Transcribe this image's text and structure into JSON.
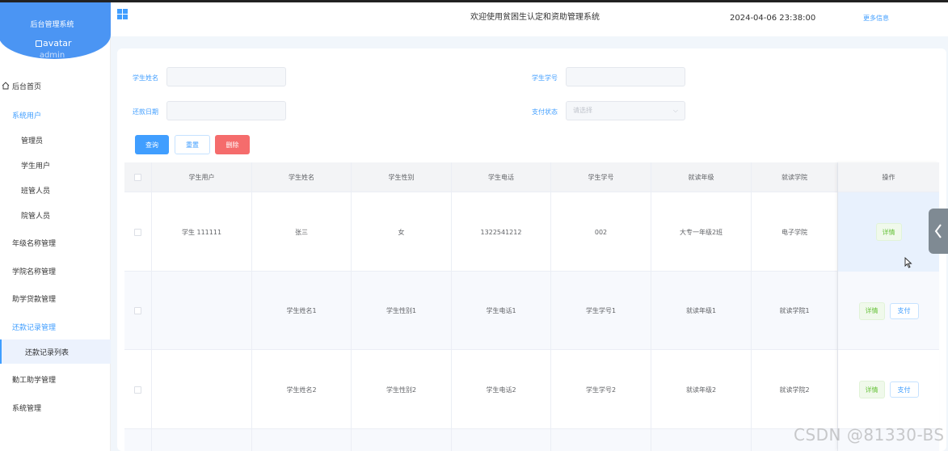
{
  "sidebar": {
    "brand_title": "后台管理系统",
    "avatar_alt": "avatar",
    "username": "admin",
    "items": [
      {
        "label": "后台首页"
      },
      {
        "label": "系统用户"
      },
      {
        "label": "管理员"
      },
      {
        "label": "学生用户"
      },
      {
        "label": "班管人员"
      },
      {
        "label": "院管人员"
      },
      {
        "label": "年级名称管理"
      },
      {
        "label": "学院名称管理"
      },
      {
        "label": "助学贷款管理"
      },
      {
        "label": "还款记录管理"
      },
      {
        "label": "还款记录列表"
      },
      {
        "label": "勤工助学管理"
      },
      {
        "label": "系统管理"
      }
    ]
  },
  "header": {
    "title": "欢迎使用贫困生认定和资助管理系统",
    "datetime": "2024-04-06 23:38:00",
    "more": "更多信息"
  },
  "search": {
    "name_label": "学生姓名",
    "id_label": "学生学号",
    "date_label": "还款日期",
    "status_label": "支付状态",
    "status_placeholder": "请选择",
    "query_btn": "查询",
    "reset_btn": "重置",
    "delete_btn": "删除"
  },
  "table": {
    "headers": [
      "学生用户",
      "学生姓名",
      "学生性别",
      "学生电话",
      "学生学号",
      "就读年级",
      "就读学院",
      "操作"
    ],
    "rows": [
      {
        "user": "学生 111111",
        "name": "张三",
        "gender": "女",
        "phone": "1322541212",
        "sid": "002",
        "grade": "大专一年级2班",
        "college": "电子学院",
        "detail": "详情",
        "pay": ""
      },
      {
        "user": "",
        "name": "学生姓名1",
        "gender": "学生性别1",
        "phone": "学生电话1",
        "sid": "学生学号1",
        "grade": "就读年级1",
        "college": "就读学院1",
        "detail": "详情",
        "pay": "支付"
      },
      {
        "user": "",
        "name": "学生姓名2",
        "gender": "学生性别2",
        "phone": "学生电话2",
        "sid": "学生学号2",
        "grade": "就读年级2",
        "college": "就读学院2",
        "detail": "详情",
        "pay": "支付"
      }
    ]
  },
  "watermark": "CSDN @81330-BS",
  "colors": {
    "primary": "#409eff",
    "danger": "#f56c6c",
    "brand": "#4b95f3",
    "success": "#67c23a"
  }
}
